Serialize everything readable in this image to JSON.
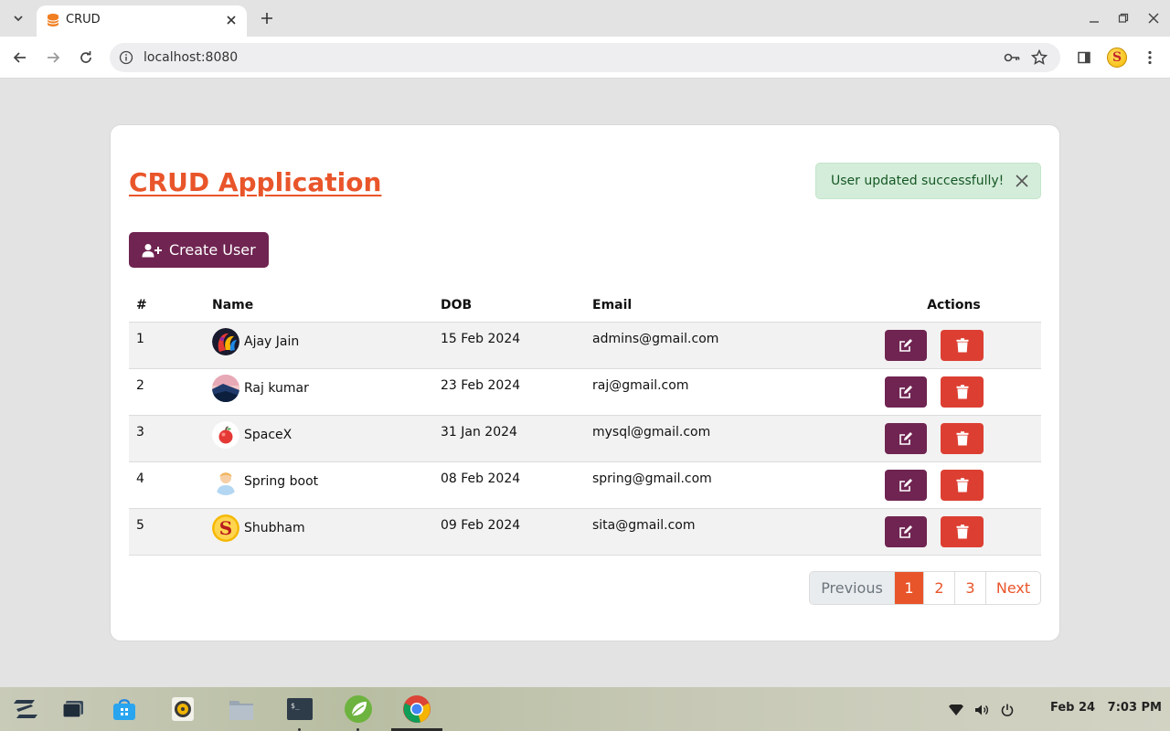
{
  "browser": {
    "tab_title": "CRUD",
    "url": "localhost:8080"
  },
  "page": {
    "title": "CRUD Application",
    "alert_message": "User updated successfully!",
    "create_button_label": "Create User",
    "table_headers": {
      "num": "#",
      "name": "Name",
      "dob": "DOB",
      "email": "Email",
      "actions": "Actions"
    },
    "users": [
      {
        "id": "1",
        "name": "Ajay Jain",
        "dob": "15 Feb 2024",
        "email": "admins@gmail.com",
        "avatar": "abstract-swirl"
      },
      {
        "id": "2",
        "name": "Raj kumar",
        "dob": "23 Feb 2024",
        "email": "raj@gmail.com",
        "avatar": "landscape"
      },
      {
        "id": "3",
        "name": "SpaceX",
        "dob": "31 Jan 2024",
        "email": "mysql@gmail.com",
        "avatar": "apple"
      },
      {
        "id": "4",
        "name": "Spring boot",
        "dob": "08 Feb 2024",
        "email": "spring@gmail.com",
        "avatar": "person"
      },
      {
        "id": "5",
        "name": "Shubham",
        "dob": "09 Feb 2024",
        "email": "sita@gmail.com",
        "avatar": "letter-s"
      }
    ],
    "pagination": {
      "previous": "Previous",
      "pages": [
        "1",
        "2",
        "3"
      ],
      "current": "1",
      "next": "Next"
    }
  },
  "taskbar": {
    "date": "Feb 24",
    "time": "7:03 PM"
  },
  "colors": {
    "accent_orange": "#e9552a",
    "primary_purple": "#6f2451",
    "danger_red": "#dc3f32",
    "alert_green_bg": "#d4edda",
    "alert_green_text": "#155724"
  }
}
